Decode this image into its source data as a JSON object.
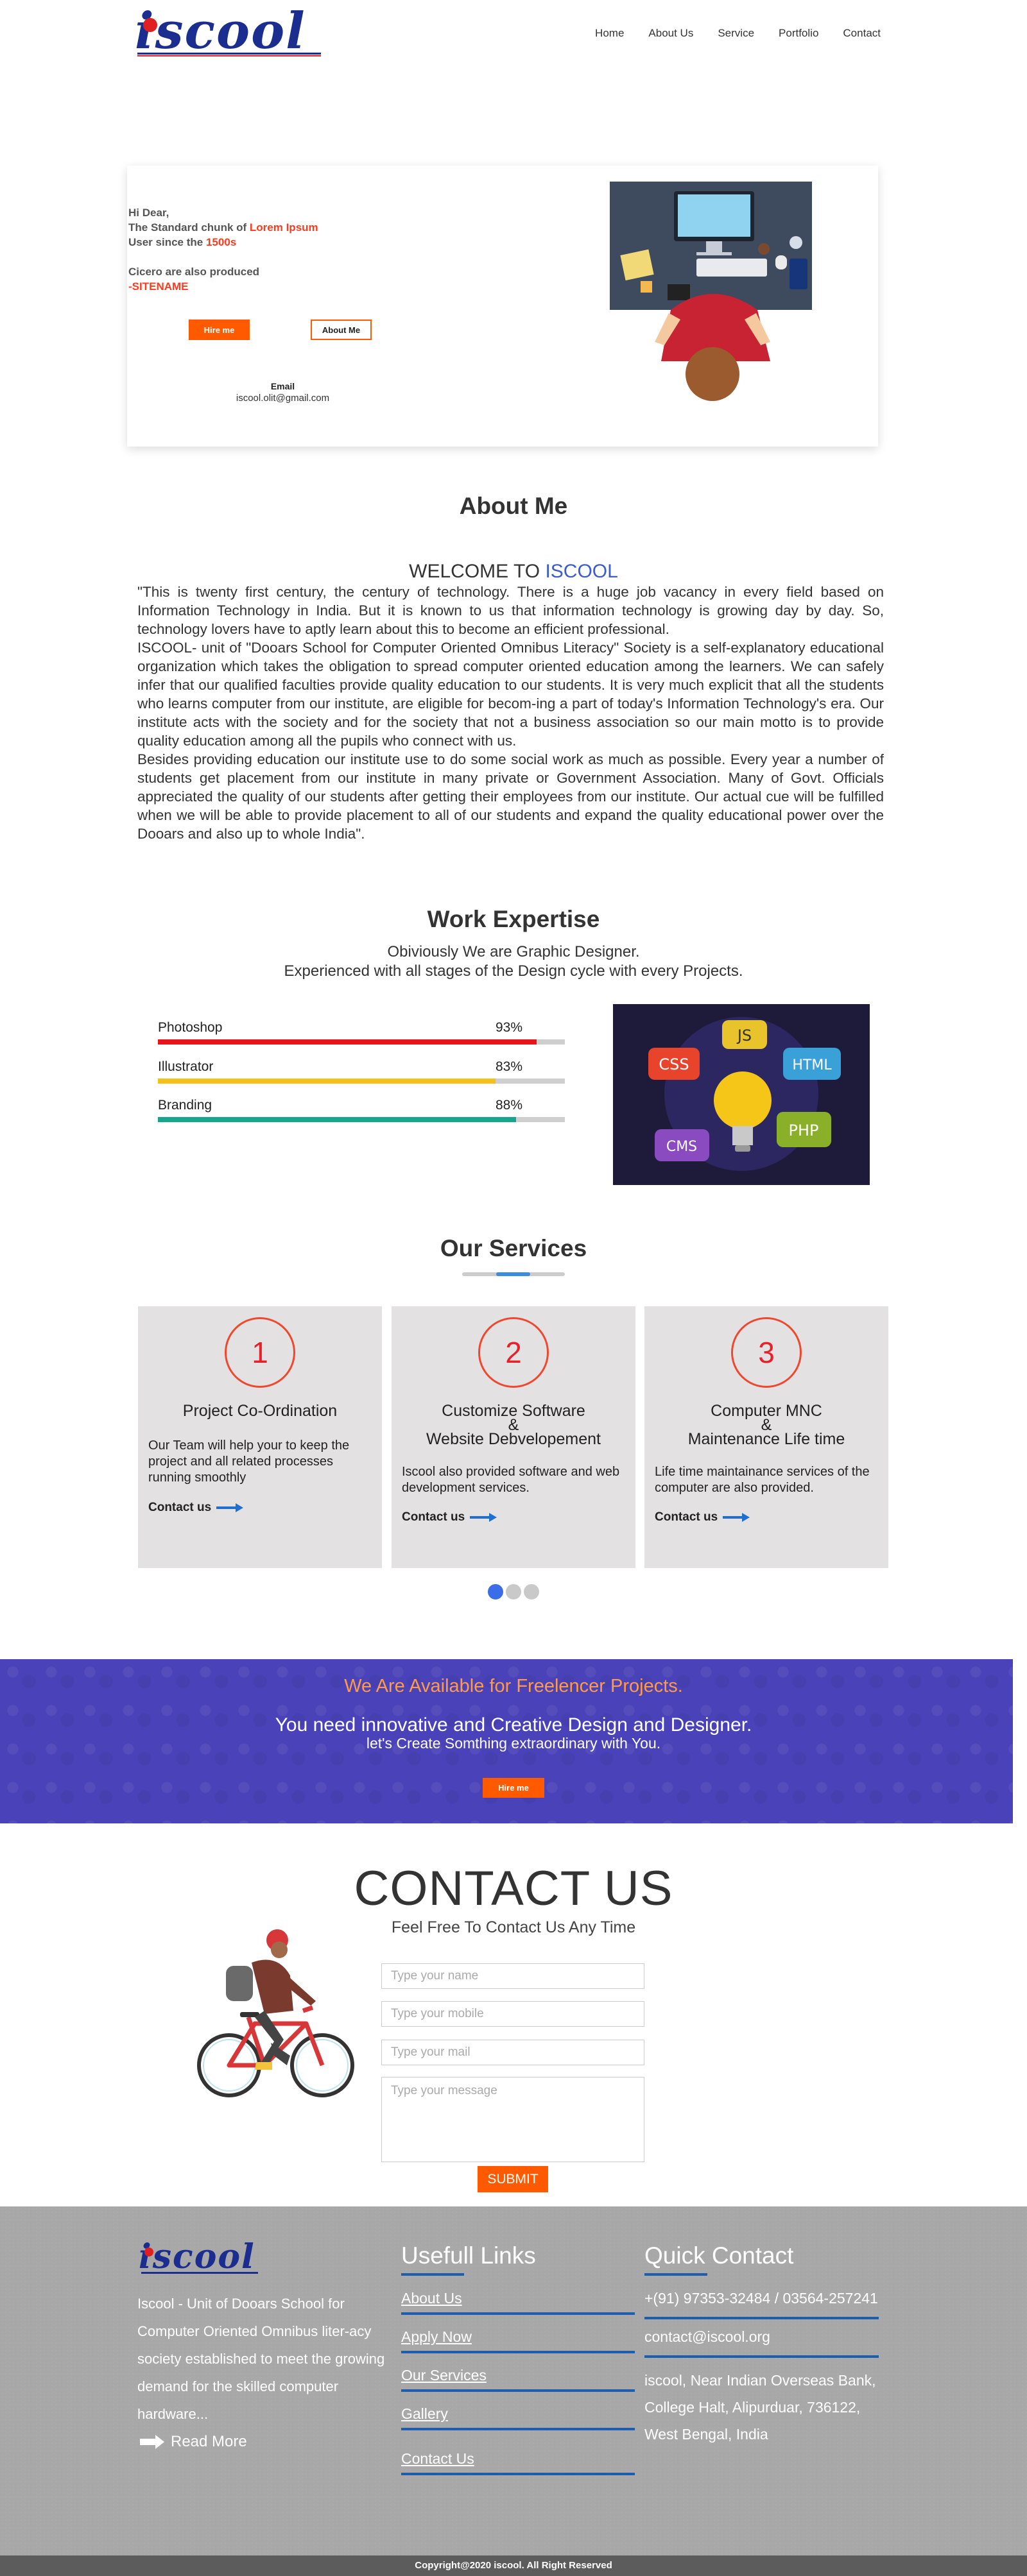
{
  "header": {
    "logo_text": "iscool",
    "nav": [
      "Home",
      "About Us",
      "Service",
      "Portfolio",
      "Contact"
    ]
  },
  "hero": {
    "greeting": "Hi Dear,",
    "line1_prefix": "The Standard chunk of ",
    "line1_highlight": "Lorem Ipsum",
    "line2_prefix": "User since the ",
    "line2_highlight": "1500s",
    "line3": "Cicero are also produced",
    "line4": "-SITENAME",
    "hire_button": "Hire me",
    "about_button": "About Me",
    "email_label": "Email",
    "email_value": "iscool.olit@gmail.com"
  },
  "about": {
    "title": "About Me",
    "welcome_prefix": "WELCOME TO ",
    "welcome_brand": "ISCOOL",
    "p1": "\"This is twenty first century, the century of technology. There is a huge job vacancy in every field based on Information Technology in India. But it is known to us that information technology is growing day by day. So, technology lovers have to aptly learn about this to become an efficient professional.",
    "p2": "ISCOOL- unit of \"Dooars School for Computer Oriented Omnibus Literacy\" Society is a self-explanatory educational organization which takes the obligation to spread computer oriented education among the learners. We can safely infer that our qualified faculties provide quality education to our students. It is very much explicit that all the students who learns computer from our institute, are eligible for becom-ing a part of today's Information Technology's era. Our institute acts with the society and for the society that not a business association so our main motto is to provide quality education among all the pupils who connect with us.",
    "p3": "Besides providing education our institute use to do some social work as much as possible. Every year a number of students get placement from our institute in many private or Government Association. Many of Govt. Officials appreciated the quality of our students after getting their employees from our institute. Our actual cue will be fulfilled when we will be able to provide placement to all of our students and expand the quality educational power over the Dooars and also up to whole India\"."
  },
  "expertise": {
    "title": "Work Expertise",
    "sub1": "Obiviously We are Graphic Designer.",
    "sub2": "Experienced with all stages of the Design cycle with every Projects.",
    "skills": [
      {
        "name": "Photoshop",
        "percent_label": "93%",
        "value": 0.93,
        "color": "#e8151b"
      },
      {
        "name": "Illustrator",
        "percent_label": "83%",
        "value": 0.83,
        "color": "#f4c01a"
      },
      {
        "name": "Branding",
        "percent_label": "88%",
        "value": 0.88,
        "color": "#16a68c"
      }
    ],
    "tech_labels": [
      "CSS",
      "JS",
      "HTML",
      "CMS",
      "PHP"
    ]
  },
  "services": {
    "title": "Our Services",
    "cards": [
      {
        "number": "1",
        "title_l1": "Project Co-Ordination",
        "title_l2": "",
        "title_l3": "",
        "desc": "Our Team will help your to keep the project and all related processes running smoothly",
        "link": "Contact us"
      },
      {
        "number": "2",
        "title_l1": "Customize Software",
        "title_l2": "&",
        "title_l3": "Website Debvelopement",
        "desc": "Iscool also provided software and web development services.",
        "link": "Contact us"
      },
      {
        "number": "3",
        "title_l1": "Computer MNC",
        "title_l2": "&",
        "title_l3": "Maintenance Life time",
        "desc": "Life time maintainance services of the computer are also provided.",
        "link": "Contact us"
      }
    ]
  },
  "banner": {
    "heading": "We Are Available for Freelencer Projects.",
    "line1": "You need innovative and Creative Design and Designer.",
    "line2": "let's Create Somthing extraordinary with You.",
    "button": "Hire me"
  },
  "contact": {
    "title": "CONTACT US",
    "subtitle": "Feel Free To Contact Us Any Time",
    "name_placeholder": "Type your name",
    "mobile_placeholder": "Type your mobile",
    "mail_placeholder": "Type your mail",
    "message_placeholder": "Type your message",
    "submit": "SUBMIT"
  },
  "footer": {
    "logo_text": "iscool",
    "about": "Iscool - Unit of Dooars School for Computer Oriented Omnibus liter-acy society established to meet the growing demand for the skilled computer hardware...",
    "read_more": "Read More",
    "links_title": "Usefull Links",
    "links": [
      "About Us",
      "Apply Now",
      "Our Services",
      "Gallery",
      "Contact Us"
    ],
    "contact_title": "Quick Contact",
    "phone": "+(91) 97353-32484 / 03564-257241",
    "email": "contact@iscool.org",
    "address": "iscool, Near Indian Overseas Bank, College Halt, Alipurduar, 736122, West Bengal, India",
    "copyright": "Copyright@2020 iscool. All Right Reserved"
  }
}
